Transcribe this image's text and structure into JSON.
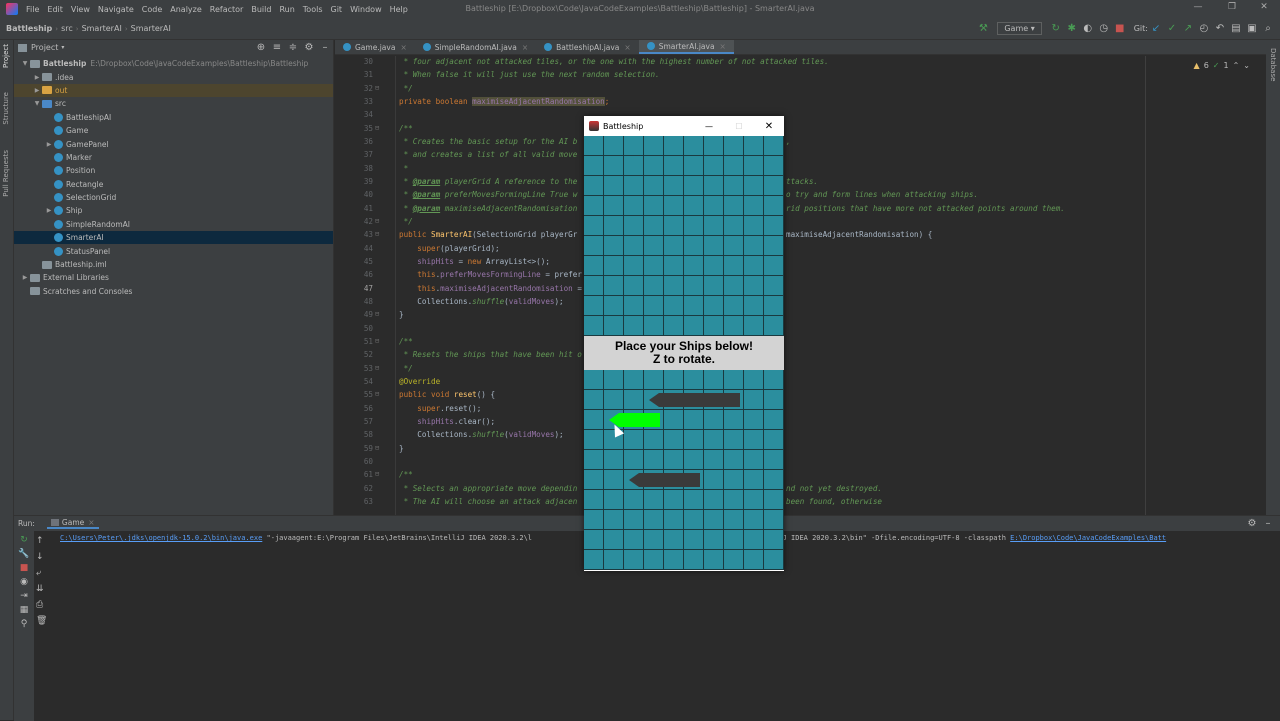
{
  "window": {
    "title": "Battleship [E:\\Dropbox\\Code\\JavaCodeExamples\\Battleship\\Battleship] - SmarterAI.java"
  },
  "menu": [
    "File",
    "Edit",
    "View",
    "Navigate",
    "Code",
    "Analyze",
    "Refactor",
    "Build",
    "Run",
    "Tools",
    "Git",
    "Window",
    "Help"
  ],
  "breadcrumb": [
    "Battleship",
    "src",
    "SmarterAI",
    "SmarterAI"
  ],
  "toolbar": {
    "run_config": "Game",
    "git_label": "Git:"
  },
  "side_labels": {
    "project": "Project",
    "structure": "Structure",
    "pull_requests": "Pull Requests",
    "database": "Database"
  },
  "project": {
    "title": "Project",
    "items": [
      {
        "label": "Battleship",
        "extra": "E:\\Dropbox\\Code\\JavaCodeExamples\\Battleship\\Battleship",
        "depth": 0,
        "kind": "module",
        "expand": "open"
      },
      {
        "label": ".idea",
        "depth": 1,
        "kind": "folder",
        "expand": "closed"
      },
      {
        "label": "out",
        "depth": 1,
        "kind": "folder-out",
        "expand": "closed",
        "highlight": true
      },
      {
        "label": "src",
        "depth": 1,
        "kind": "folder-src",
        "expand": "open"
      },
      {
        "label": "BattleshipAI",
        "depth": 2,
        "kind": "class"
      },
      {
        "label": "Game",
        "depth": 2,
        "kind": "class"
      },
      {
        "label": "GamePanel",
        "depth": 2,
        "kind": "class",
        "expand": "closed"
      },
      {
        "label": "Marker",
        "depth": 2,
        "kind": "class"
      },
      {
        "label": "Position",
        "depth": 2,
        "kind": "class"
      },
      {
        "label": "Rectangle",
        "depth": 2,
        "kind": "class"
      },
      {
        "label": "SelectionGrid",
        "depth": 2,
        "kind": "class"
      },
      {
        "label": "Ship",
        "depth": 2,
        "kind": "class",
        "expand": "closed"
      },
      {
        "label": "SimpleRandomAI",
        "depth": 2,
        "kind": "class"
      },
      {
        "label": "SmarterAI",
        "depth": 2,
        "kind": "class",
        "selected": true
      },
      {
        "label": "StatusPanel",
        "depth": 2,
        "kind": "class"
      },
      {
        "label": "Battleship.iml",
        "depth": 1,
        "kind": "file"
      },
      {
        "label": "External Libraries",
        "depth": 0,
        "kind": "lib",
        "expand": "closed"
      },
      {
        "label": "Scratches and Consoles",
        "depth": 0,
        "kind": "scratch"
      }
    ]
  },
  "tabs": [
    {
      "label": "Game.java"
    },
    {
      "label": "SimpleRandomAI.java"
    },
    {
      "label": "BattleshipAI.java"
    },
    {
      "label": "SmarterAI.java",
      "active": true
    }
  ],
  "inspections": {
    "warnings": "6",
    "ok": "1"
  },
  "code": [
    {
      "n": "30",
      "segs": [
        [
          "c",
          " * four adjacent not attacked tiles, or the one with the highest number of not attacked tiles."
        ]
      ]
    },
    {
      "n": "31",
      "segs": [
        [
          "c",
          " * When false it will just use the next random selection."
        ]
      ]
    },
    {
      "n": "32",
      "segs": [
        [
          "c",
          " */"
        ]
      ]
    },
    {
      "n": "33",
      "segs": [
        [
          "k",
          "private boolean "
        ],
        [
          "h",
          "maximiseAdjacentRandomisation"
        ],
        [
          "k",
          ";"
        ]
      ]
    },
    {
      "n": "34",
      "segs": []
    },
    {
      "n": "35",
      "segs": [
        [
          "c",
          "/**"
        ]
      ]
    },
    {
      "n": "36",
      "segs": [
        [
          "c",
          " * Creates the basic setup for the AI b"
        ]
      ],
      "right": [
        [
          "c",
          ","
        ]
      ]
    },
    {
      "n": "37",
      "segs": [
        [
          "c",
          " * and creates a list of all valid move"
        ]
      ]
    },
    {
      "n": "38",
      "segs": [
        [
          "c",
          " *"
        ]
      ]
    },
    {
      "n": "39",
      "segs": [
        [
          "c",
          " * "
        ],
        [
          "p",
          "@param"
        ],
        [
          "c",
          " playerGrid A reference to the"
        ]
      ],
      "right": [
        [
          "c",
          "ttacks."
        ]
      ]
    },
    {
      "n": "40",
      "segs": [
        [
          "c",
          " * "
        ],
        [
          "p",
          "@param"
        ],
        [
          "c",
          " preferMovesFormingLine True w"
        ]
      ],
      "right": [
        [
          "c",
          "o try and form lines when attacking ships."
        ]
      ]
    },
    {
      "n": "41",
      "segs": [
        [
          "c",
          " * "
        ],
        [
          "p",
          "@param"
        ],
        [
          "c",
          " maximiseAdjacentRandomisation"
        ]
      ],
      "right": [
        [
          "c",
          "rid positions that have more not attacked points around them."
        ]
      ]
    },
    {
      "n": "42",
      "segs": [
        [
          "c",
          " */"
        ]
      ]
    },
    {
      "n": "43",
      "segs": [
        [
          "k",
          "public "
        ],
        [
          "m",
          "SmarterAI"
        ],
        [
          "t",
          "(SelectionGrid playerGr"
        ]
      ],
      "right": [
        [
          "t",
          "maximiseAdjacentRandomisation) {"
        ]
      ]
    },
    {
      "n": "44",
      "segs": [
        [
          "t",
          "    "
        ],
        [
          "k",
          "super"
        ],
        [
          "t",
          "(playerGrid);"
        ]
      ]
    },
    {
      "n": "45",
      "segs": [
        [
          "t",
          "    "
        ],
        [
          "f",
          "shipHits"
        ],
        [
          "t",
          " = "
        ],
        [
          "k",
          "new "
        ],
        [
          "t",
          "ArrayList<>();"
        ]
      ]
    },
    {
      "n": "46",
      "segs": [
        [
          "t",
          "    "
        ],
        [
          "k",
          "this"
        ],
        [
          "t",
          "."
        ],
        [
          "f",
          "preferMovesFormingLine"
        ],
        [
          "t",
          " = prefer"
        ]
      ]
    },
    {
      "n": "47",
      "segs": [
        [
          "t",
          "    "
        ],
        [
          "k",
          "this"
        ],
        [
          "t",
          "."
        ],
        [
          "f",
          "maximiseAdjacentRandomisation"
        ],
        [
          "t",
          " ="
        ]
      ]
    },
    {
      "n": "48",
      "segs": [
        [
          "t",
          "    Collections."
        ],
        [
          "c",
          "shuffle"
        ],
        [
          "t",
          "("
        ],
        [
          "f",
          "validMoves"
        ],
        [
          "t",
          ");"
        ]
      ]
    },
    {
      "n": "49",
      "segs": [
        [
          "t",
          "}"
        ]
      ]
    },
    {
      "n": "50",
      "segs": []
    },
    {
      "n": "51",
      "segs": [
        [
          "c",
          "/**"
        ]
      ]
    },
    {
      "n": "52",
      "segs": [
        [
          "c",
          " * Resets the ships that have been hit o"
        ]
      ]
    },
    {
      "n": "53",
      "segs": [
        [
          "c",
          " */"
        ]
      ]
    },
    {
      "n": "54",
      "segs": [
        [
          "a",
          "@Override"
        ]
      ]
    },
    {
      "n": "55",
      "segs": [
        [
          "k",
          "public void "
        ],
        [
          "m",
          "reset"
        ],
        [
          "t",
          "() {"
        ]
      ]
    },
    {
      "n": "56",
      "segs": [
        [
          "t",
          "    "
        ],
        [
          "k",
          "super"
        ],
        [
          "t",
          ".reset();"
        ]
      ]
    },
    {
      "n": "57",
      "segs": [
        [
          "t",
          "    "
        ],
        [
          "f",
          "shipHits"
        ],
        [
          "t",
          ".clear();"
        ]
      ]
    },
    {
      "n": "58",
      "segs": [
        [
          "t",
          "    Collections."
        ],
        [
          "c",
          "shuffle"
        ],
        [
          "t",
          "("
        ],
        [
          "f",
          "validMoves"
        ],
        [
          "t",
          ");"
        ]
      ]
    },
    {
      "n": "59",
      "segs": [
        [
          "t",
          "}"
        ]
      ]
    },
    {
      "n": "60",
      "segs": []
    },
    {
      "n": "61",
      "segs": [
        [
          "c",
          "/**"
        ]
      ]
    },
    {
      "n": "62",
      "segs": [
        [
          "c",
          " * Selects an appropriate move dependin"
        ]
      ],
      "right": [
        [
          "c",
          "nd not yet destroyed."
        ]
      ]
    },
    {
      "n": "63",
      "segs": [
        [
          "c",
          " * The AI will choose an attack adjacen"
        ]
      ],
      "right": [
        [
          "c",
          "been found, otherwise"
        ]
      ]
    }
  ],
  "run": {
    "label": "Run:",
    "tab": "Game",
    "console": {
      "java_path": "C:\\Users\\Peter\\.jdks\\openjdk-15.0.2\\bin\\java.exe",
      "args_left": " \"-javaagent:E:\\Program Files\\JetBrains\\IntelliJ IDEA 2020.3.2\\l",
      "args_right": "ains\\IntelliJ IDEA 2020.3.2\\bin\" -Dfile.encoding=UTF-8 -classpath ",
      "classpath": "E:\\Dropbox\\Code\\JavaCodeExamples\\Batt"
    }
  },
  "game": {
    "title": "Battleship",
    "status_line1": "Place your Ships below!",
    "status_line2": "Z to rotate.",
    "grid_size": 10,
    "ships": [
      {
        "row": 1,
        "col": 3,
        "length": 5,
        "color": "#3a3a3a",
        "placed": true
      },
      {
        "row": 2,
        "col": 1,
        "length": 3,
        "color": "#00ff00",
        "placed": false
      },
      {
        "row": 5,
        "col": 2,
        "length": 4,
        "color": "#3a3a3a",
        "placed": true
      }
    ],
    "colors": {
      "water": "#2b8e9e",
      "grid_line": "#1a3a40",
      "status_bg": "#d3d3d3"
    }
  }
}
